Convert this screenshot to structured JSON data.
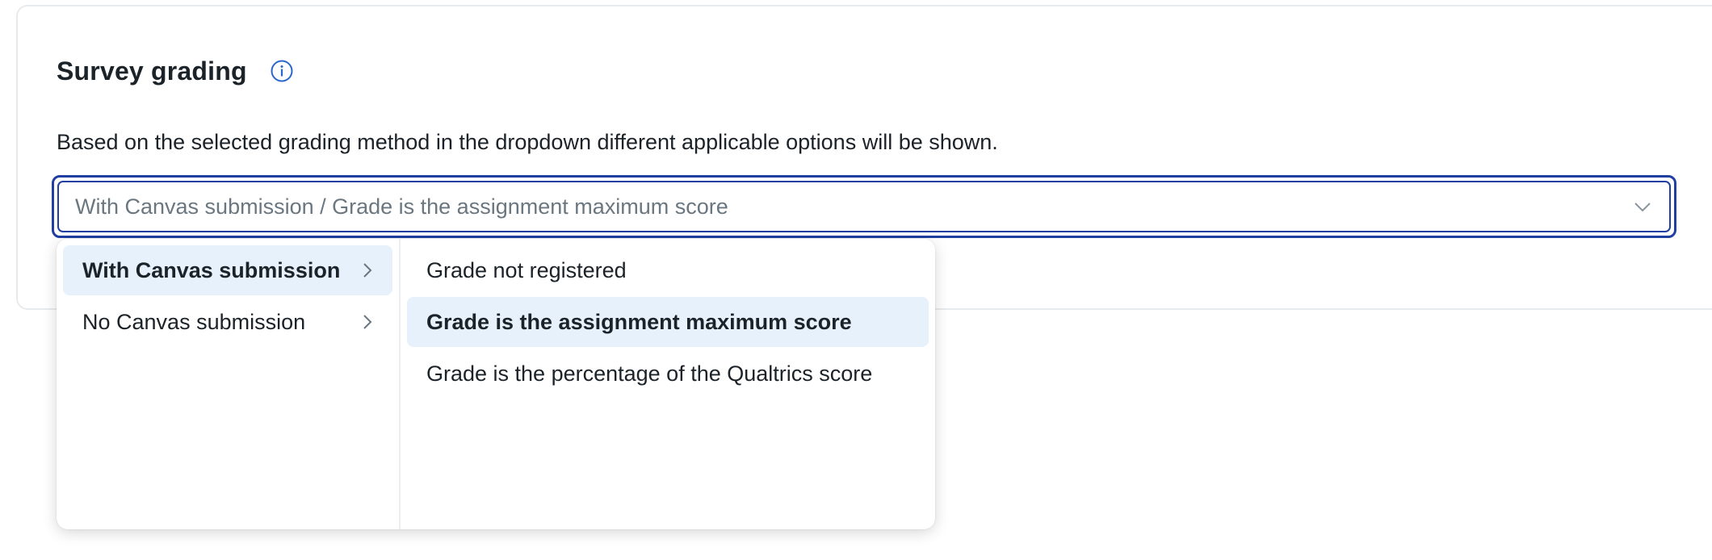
{
  "section": {
    "title": "Survey grading",
    "info_icon": "info-circle-icon",
    "description": "Based on the selected grading method in the dropdown different applicable options will be shown."
  },
  "select": {
    "value": "With Canvas submission / Grade is the assignment maximum score",
    "icon": "chevron-down-icon"
  },
  "dropdown": {
    "categories": [
      {
        "label": "With Canvas submission",
        "active": true
      },
      {
        "label": "No Canvas submission",
        "active": false
      }
    ],
    "options": [
      {
        "label": "Grade not registered",
        "selected": false
      },
      {
        "label": "Grade is the assignment maximum score",
        "selected": true
      },
      {
        "label": "Grade is the percentage of the Qualtrics score",
        "selected": false
      }
    ]
  },
  "colors": {
    "accent": "#1f3fa3",
    "info_icon": "#2b66c9",
    "highlight": "#e6f1fc",
    "text": "#1b2228",
    "muted": "#6b7780"
  }
}
